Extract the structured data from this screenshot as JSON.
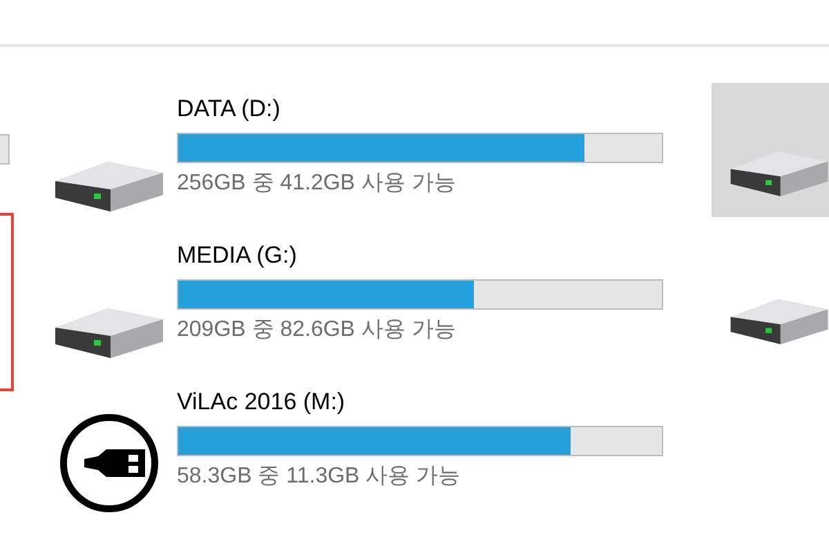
{
  "left_drive": {
    "outlined": true
  },
  "drives": [
    {
      "kind": "disk",
      "name": "DATA (D:)",
      "level": 0.84,
      "usage": "256GB 중 41.2GB 사용 가능"
    },
    {
      "kind": "disk",
      "name": "MEDIA (G:)",
      "level": 0.61,
      "usage": "209GB 중 82.6GB 사용 가능"
    },
    {
      "kind": "usb",
      "name": "ViLAc 2016 (M:)",
      "level": 0.81,
      "usage": "58.3GB 중 11.3GB 사용 가능"
    }
  ],
  "right_drives": [
    {
      "kind": "disk",
      "selected": true
    },
    {
      "kind": "disk",
      "selected": false
    }
  ]
}
